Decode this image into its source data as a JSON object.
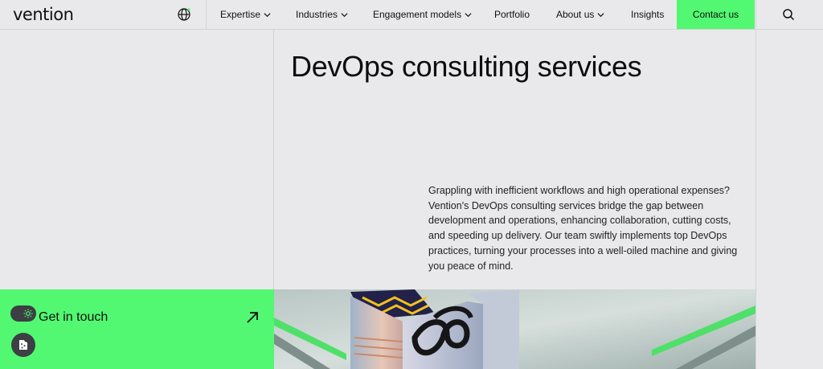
{
  "header": {
    "logo": "vention",
    "nav": [
      {
        "label": "Expertise",
        "dropdown": true
      },
      {
        "label": "Industries",
        "dropdown": true
      },
      {
        "label": "Engagement models",
        "dropdown": true
      },
      {
        "label": "Portfolio",
        "dropdown": false
      },
      {
        "label": "About us",
        "dropdown": true
      },
      {
        "label": "Insights",
        "dropdown": false
      }
    ],
    "contact_label": "Contact us"
  },
  "hero": {
    "title": "DevOps consulting services",
    "description": "Grappling with inefficient workflows and high operational expenses? Vention's DevOps consulting services bridge the gap between development and operations, enhancing collaboration, cutting costs, and speeding up delivery. Our team swiftly implements top DevOps practices, turning your processes into a well-oiled machine and giving you peace of mind."
  },
  "cta": {
    "label": "Get in touch"
  },
  "colors": {
    "background": "#e9e9eb",
    "accent": "#52f871",
    "widget": "#3c3f44"
  },
  "icons": {
    "globe": "globe-icon",
    "search": "search-icon",
    "arrow": "arrow-up-right-icon",
    "theme": "sun-icon",
    "cookie": "cookie-icon"
  }
}
